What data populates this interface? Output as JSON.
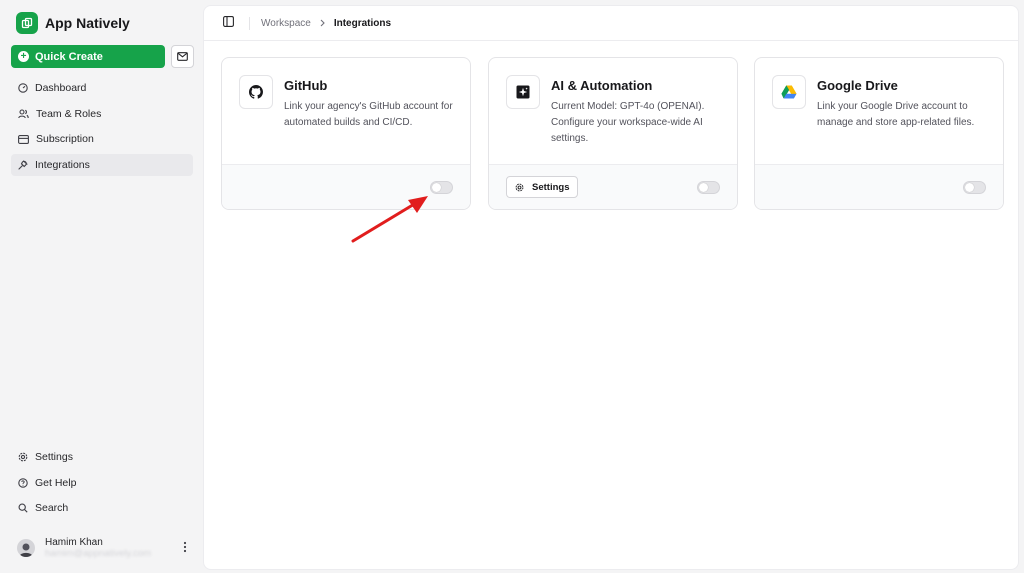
{
  "app": {
    "name": "App Natively",
    "brand_color": "#16a34a"
  },
  "sidebar": {
    "quick_create_label": "Quick Create",
    "mail_icon": "mail-icon",
    "nav_items": [
      {
        "label": "Dashboard",
        "icon": "gauge-icon"
      },
      {
        "label": "Team & Roles",
        "icon": "users-icon"
      },
      {
        "label": "Subscription",
        "icon": "credit-card-icon"
      },
      {
        "label": "Integrations",
        "icon": "plug-icon",
        "active": true
      }
    ],
    "bottom_items": [
      {
        "label": "Settings",
        "icon": "gear-icon"
      },
      {
        "label": "Get Help",
        "icon": "help-circle-icon"
      },
      {
        "label": "Search",
        "icon": "search-icon"
      }
    ],
    "user": {
      "name": "Hamim Khan",
      "email": "hamim@appnatively.com"
    }
  },
  "breadcrumb": {
    "parent": "Workspace",
    "current": "Integrations"
  },
  "integrations": [
    {
      "title": "GitHub",
      "icon": "github-icon",
      "description": "Link your agency's GitHub account for automated builds and CI/CD.",
      "enabled": false
    },
    {
      "title": "AI & Automation",
      "icon": "sparkle-icon",
      "description": "Current Model: GPT-4o (OPENAI). Configure your workspace-wide AI settings.",
      "settings_label": "Settings",
      "enabled": false
    },
    {
      "title": "Google Drive",
      "icon": "google-drive-icon",
      "description": "Link your Google Drive account to manage and store app-related files.",
      "enabled": false
    }
  ],
  "annotation": {
    "arrow_color": "#e11d1d"
  }
}
